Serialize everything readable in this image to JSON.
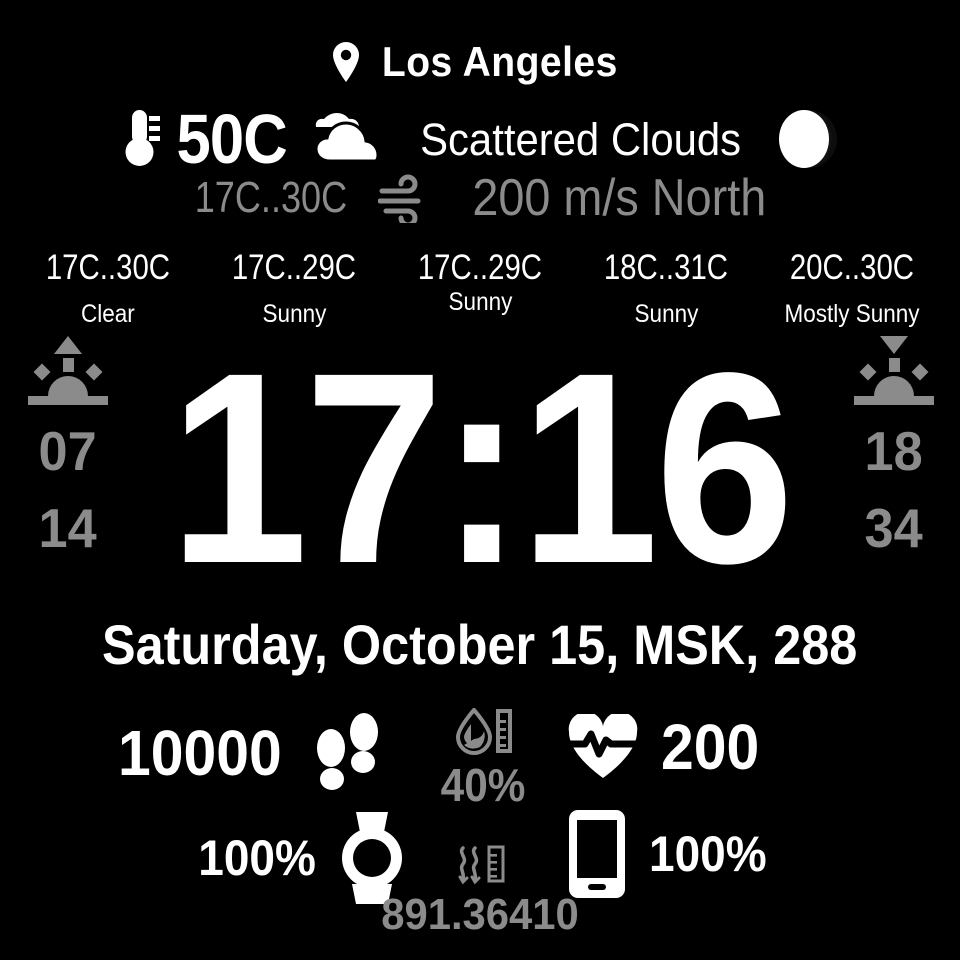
{
  "location": {
    "name": "Los Angeles",
    "icon": "map-pin-icon"
  },
  "current_weather": {
    "temperature": "50C",
    "condition": "Scattered Clouds",
    "range": "17C..30C",
    "wind": "200 m/s North",
    "thermometer_icon": "thermometer-icon",
    "condition_icon": "scattered-clouds-icon",
    "moon_icon": "moon-phase-icon",
    "wind_icon": "wind-icon"
  },
  "forecast": [
    {
      "range": "17C..30C",
      "description": "Clear"
    },
    {
      "range": "17C..29C",
      "description": "Sunny"
    },
    {
      "range": "17C..29C",
      "description": "Sunny"
    },
    {
      "range": "18C..31C",
      "description": "Sunny"
    },
    {
      "range": "20C..30C",
      "description": "Mostly Sunny"
    }
  ],
  "sunrise": {
    "hour": "07",
    "minute": "14",
    "icon": "sunrise-icon"
  },
  "sunset": {
    "hour": "18",
    "minute": "34",
    "icon": "sunset-icon"
  },
  "clock": {
    "time": "17:16"
  },
  "date": {
    "text": "Saturday, October 15, MSK, 288"
  },
  "stats": {
    "steps": {
      "value": "10000",
      "icon": "footprints-icon"
    },
    "humidity": {
      "value": "40%",
      "icon": "humidity-icon"
    },
    "heart_rate": {
      "value": "200",
      "icon": "heart-pulse-icon"
    },
    "watch_battery": {
      "value": "100%",
      "icon": "watch-icon"
    },
    "phone_battery": {
      "value": "100%",
      "icon": "phone-icon"
    },
    "pressure": {
      "value": "891.36410",
      "icon": "pressure-icon"
    }
  },
  "colors": {
    "background": "#000000",
    "primary_text": "#ffffff",
    "secondary_text": "#8b8b8b"
  }
}
